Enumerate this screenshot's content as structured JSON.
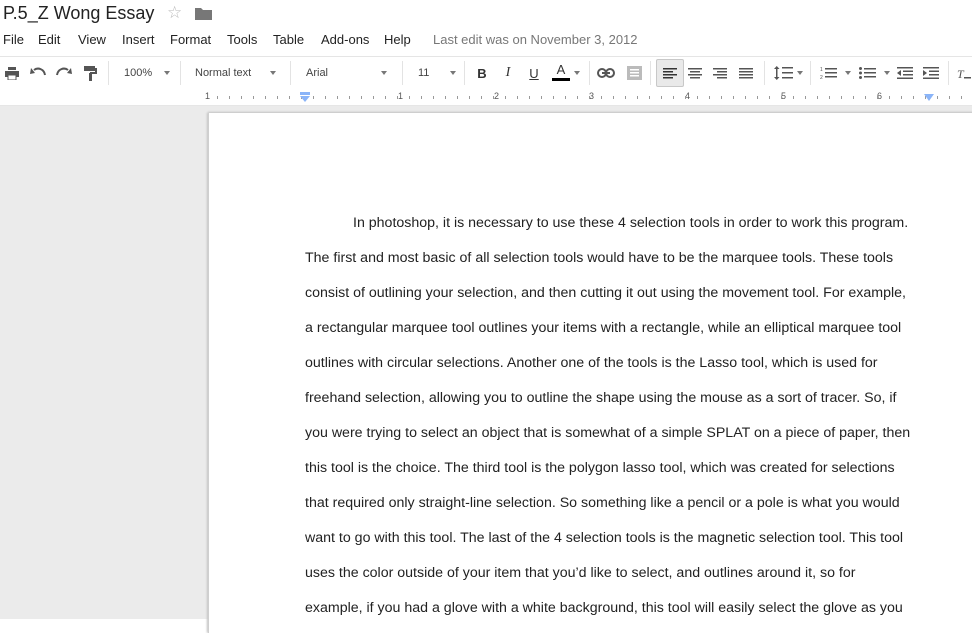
{
  "doc": {
    "title": "P.5_Z Wong Essay",
    "star_glyph": "☆"
  },
  "menu": {
    "items": [
      "File",
      "Edit",
      "View",
      "Insert",
      "Format",
      "Tools",
      "Table",
      "Add-ons",
      "Help"
    ],
    "last_edit": "Last edit was on November 3, 2012"
  },
  "toolbar": {
    "zoom": "100%",
    "style": "Normal text",
    "font": "Arial",
    "font_size": "11",
    "bold": "B",
    "italic": "I",
    "underline": "U",
    "text_color": "A",
    "text_color_value": "#000000",
    "icons": [
      "print-icon",
      "undo-icon",
      "redo-icon",
      "paint-format-icon",
      "link-icon",
      "comment-icon",
      "align-left-icon",
      "align-center-icon",
      "align-right-icon",
      "justify-icon",
      "line-spacing-icon",
      "numbered-list-icon",
      "bulleted-list-icon",
      "decrease-indent-icon",
      "increase-indent-icon",
      "clear-formatting-icon"
    ]
  },
  "ruler": {
    "numbers": [
      "1",
      "1",
      "2",
      "3",
      "4",
      "5",
      "6"
    ]
  },
  "body": {
    "lines": [
      "In photoshop, it is necessary to use these 4 selection tools in order to work this program.",
      "The first and most basic of all selection tools would have to be the marquee tools. These tools",
      "consist of outlining your selection, and then cutting it out using the movement tool. For example,",
      "a rectangular marquee tool outlines your items with a rectangle, while an elliptical marquee tool",
      "outlines with circular selections.  Another one of the tools is the Lasso tool, which is used for",
      "freehand selection, allowing you to outline the shape using the mouse as a sort of tracer. So, if",
      "you were trying to select an object that is somewhat of a simple SPLAT on a piece of paper, then",
      "this tool is the choice. The third tool is the polygon lasso tool, which was created for selections",
      "that required only straight-line selection. So something like a pencil or a pole is what you would",
      "want to go with this tool. The last of the 4 selection tools is the magnetic selection tool. This tool",
      "uses the color outside of your item that you’d like to select, and outlines around it, so for",
      "example, if you had a glove with a white background, this tool will easily select the glove as you"
    ]
  },
  "colors": {
    "canvas_bg": "#ebebeb",
    "text": "#222222",
    "muted": "#777777",
    "indent_marker": "#8ab4f8"
  }
}
